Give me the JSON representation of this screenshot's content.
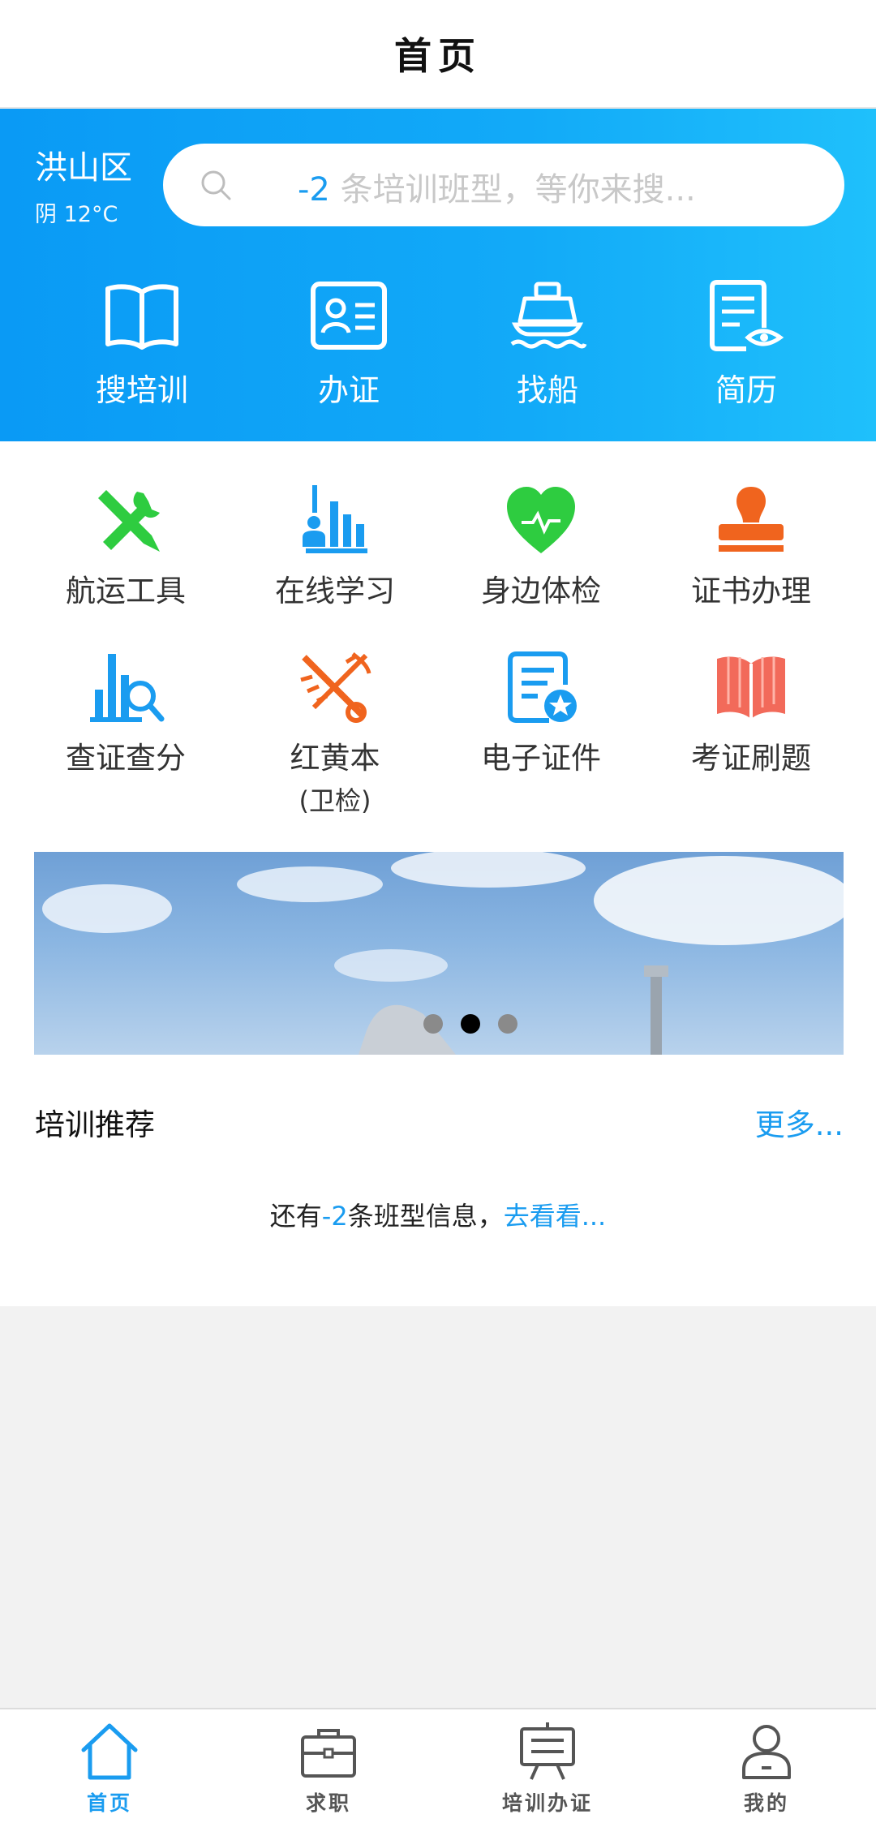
{
  "header": {
    "title": "首页"
  },
  "location": {
    "city": "洪山区",
    "weather": "阴 12°C"
  },
  "search": {
    "count": "-2",
    "placeholder_rest": " 条培训班型，等你来搜..."
  },
  "hero_actions": [
    {
      "label": "搜培训",
      "icon": "open-book-icon"
    },
    {
      "label": "办证",
      "icon": "id-card-icon"
    },
    {
      "label": "找船",
      "icon": "ship-icon"
    },
    {
      "label": "简历",
      "icon": "resume-eye-icon"
    }
  ],
  "grid": [
    {
      "label": "航运工具",
      "icon": "tools-icon",
      "color": "#2ecc40"
    },
    {
      "label": "在线学习",
      "icon": "study-chart-icon",
      "color": "#1a9cf0"
    },
    {
      "label": "身边体检",
      "icon": "heart-icon",
      "color": "#2ecc40"
    },
    {
      "label": "证书办理",
      "icon": "stamp-icon",
      "color": "#f0641e"
    },
    {
      "label": "查证查分",
      "icon": "chart-search-icon",
      "color": "#1a9cf0"
    },
    {
      "label": "红黄本",
      "sub": "(卫检)",
      "icon": "caduceus-icon",
      "color": "#f0641e"
    },
    {
      "label": "电子证件",
      "icon": "e-certificate-icon",
      "color": "#1a9cf0"
    },
    {
      "label": "考证刷题",
      "icon": "book-icon",
      "color": "#f26a5a"
    }
  ],
  "banner": {
    "slides": 3,
    "active_index": 1
  },
  "recommend": {
    "title": "培训推荐",
    "more": "更多...",
    "info_prefix": "还有",
    "info_count": "-2",
    "info_mid": "条班型信息，",
    "info_link": "去看看..."
  },
  "tabs": [
    {
      "label": "首页",
      "icon": "home-icon",
      "active": true
    },
    {
      "label": "求职",
      "icon": "briefcase-icon",
      "active": false
    },
    {
      "label": "培训办证",
      "icon": "presentation-board-icon",
      "active": false
    },
    {
      "label": "我的",
      "icon": "user-icon",
      "active": false
    }
  ],
  "colors": {
    "primary": "#1a9cf0",
    "green": "#2ecc40",
    "orange": "#f0641e"
  }
}
